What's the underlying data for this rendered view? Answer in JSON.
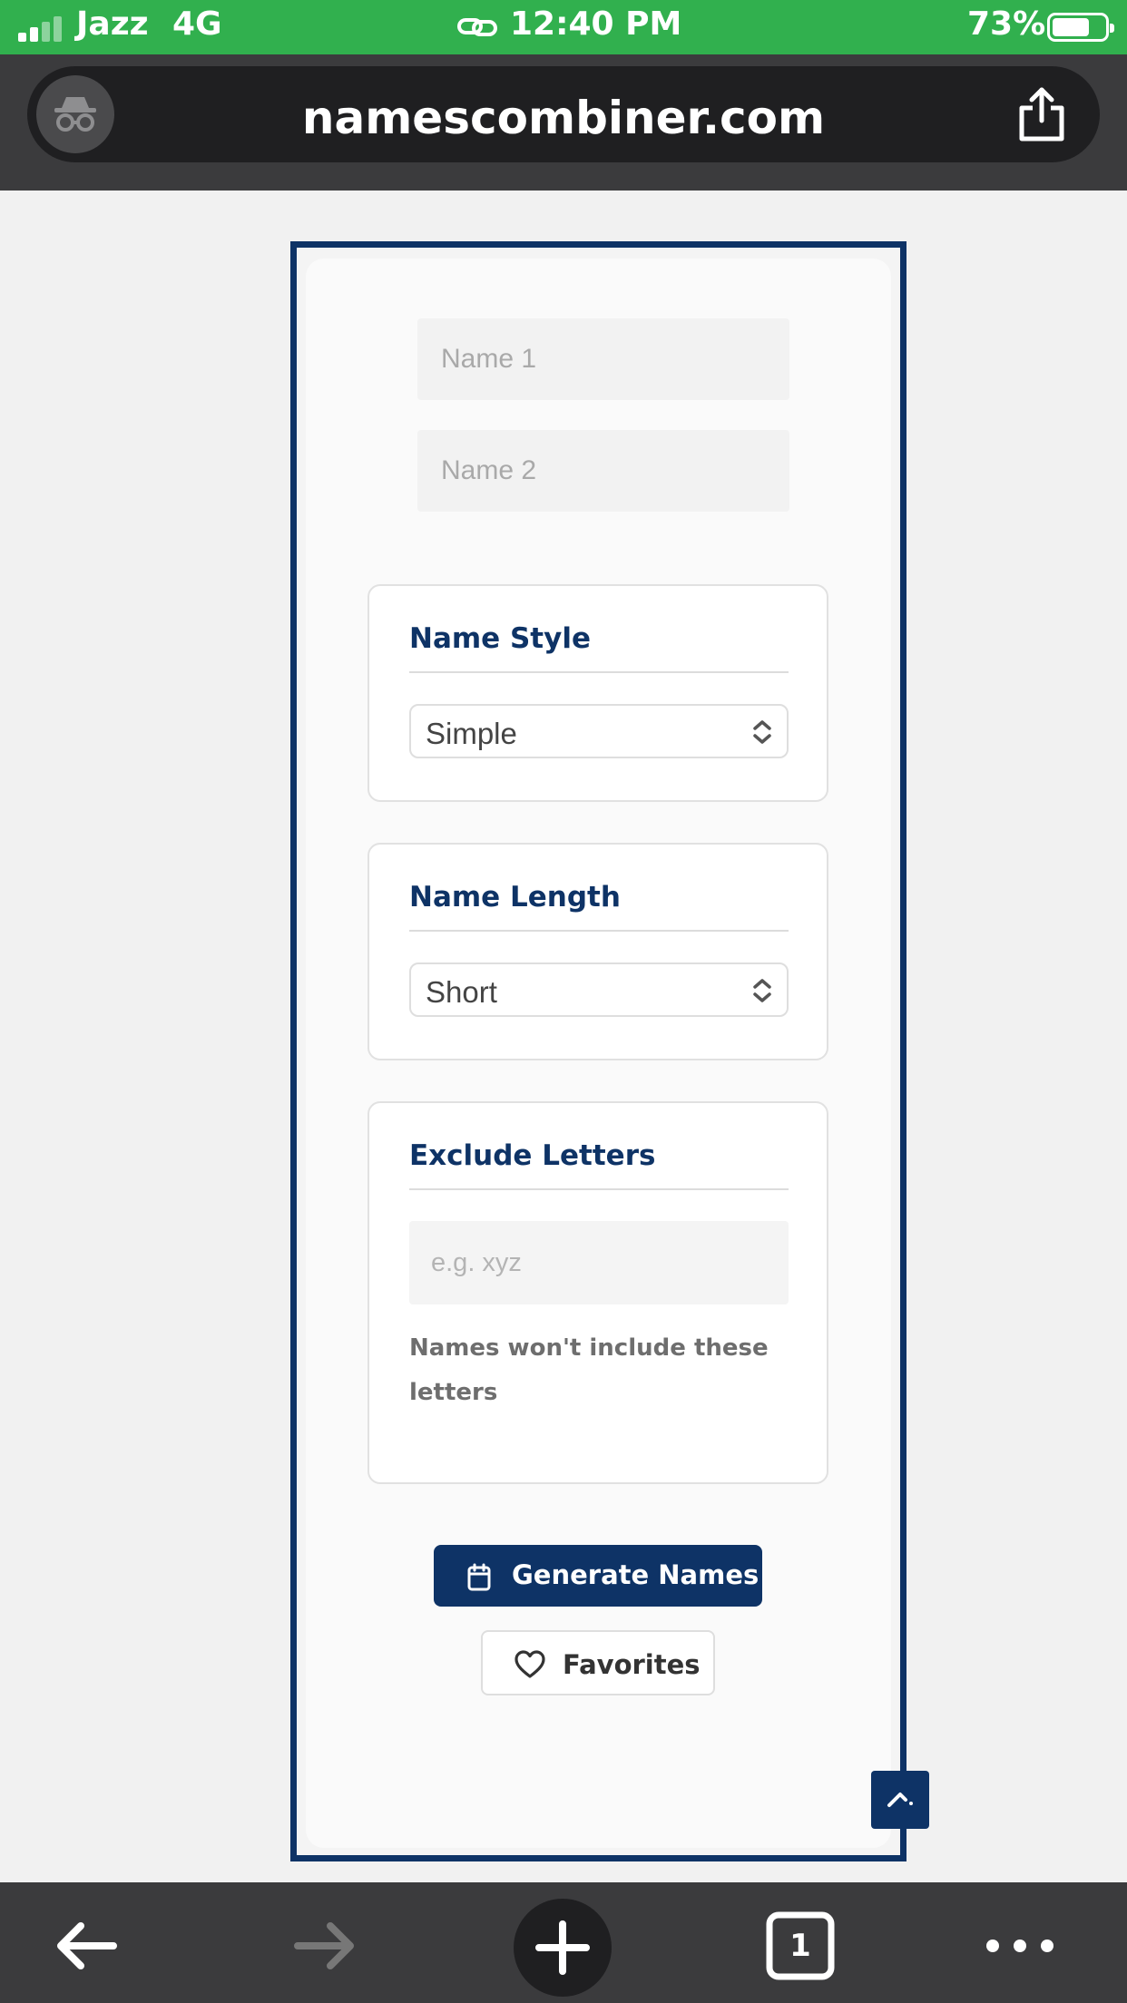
{
  "status_bar": {
    "carrier": "Jazz",
    "network": "4G",
    "time": "12:40 PM",
    "battery_percent": "73%",
    "battery_level": 0.73
  },
  "browser": {
    "url": "namescombiner.com"
  },
  "form": {
    "name1_placeholder": "Name 1",
    "name2_placeholder": "Name 2",
    "name_style": {
      "title": "Name Style",
      "value": "Simple"
    },
    "name_length": {
      "title": "Name Length",
      "value": "Short"
    },
    "exclude_letters": {
      "title": "Exclude Letters",
      "placeholder": "e.g. xyz",
      "help": "Names won't include these letters"
    },
    "generate_label": "Generate Names",
    "favorites_label": "Favorites"
  },
  "toolbar": {
    "tab_count": "1"
  },
  "colors": {
    "status_green": "#31b04e",
    "brand_navy": "#0e3366",
    "browser_dark": "#3b3b3d"
  },
  "icons": [
    "incognito-icon",
    "share-icon",
    "clipboard-icon",
    "heart-icon",
    "chevron-up-icon",
    "back-arrow-icon",
    "forward-arrow-icon",
    "plus-icon",
    "tabs-icon",
    "more-icon",
    "link-icon"
  ]
}
